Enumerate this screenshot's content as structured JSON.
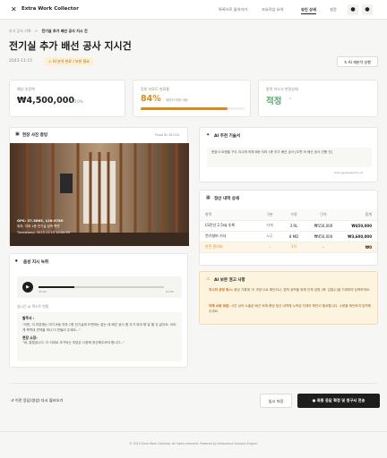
{
  "app": {
    "title": "Extra Work Collector"
  },
  "nav": {
    "items": [
      "특록으로 돌아가기",
      "조요작업 요약",
      "승인 상세",
      "설정"
    ],
    "active_index": 2
  },
  "breadcrumb": {
    "parent": "추가 공사 기록",
    "separator": ">",
    "current": "전기실 추가 배선 공사 지시 건"
  },
  "page": {
    "title": "전기실 추가 배선 공사 지시건",
    "date": "2023-11-15",
    "badge": "AI 분석 완료 / 보완 필요",
    "reanalyze_label": "AI 재분석 실행"
  },
  "stats": {
    "amount": {
      "label": "예상 추정액",
      "value": "₩4,500,000",
      "delta": "+0.0%"
    },
    "progress": {
      "label": "증빙 자료도 완료율",
      "value": "84%",
      "sub": "데이터 보완 대상",
      "fill": 0.84
    },
    "status": {
      "label": "법적 리스크 판정상태",
      "value": "적정",
      "suffix": "⌃"
    }
  },
  "photo": {
    "title": "현장 사진 증빙",
    "photo_id": "Photo ID: 827421",
    "gps": "GPS: 37.5665, 126.9780",
    "location": "위치: 지하 1층 전기실 남측 벽면",
    "timestamp": "Timestamp: 2023-11-15 14:00:09"
  },
  "voice": {
    "title": "음성 지시 녹취",
    "time_start": "00:00",
    "time_end": "02:05",
    "transcript_label": "실시간 AI 텍스트 변환",
    "quote1": "\"이번, 이 부분에는 여기 B동 지하 1층 전기실에 도면에는 없는 데 배선 공사 좀 추가 되야 해 일 할 것 같아요. 이러게 목역내 견적을 하나 더 만들어 주세요...\"",
    "quote2_label": "현장 소장:",
    "quote2": "\"네, 알겠습니다. 다 이대로 추가되는 부분은 나중에 정산해주셔야 합니다...\""
  },
  "summary": {
    "title": "AI 추천 기술서",
    "body": "현장사 요청을 구두 지시에 의해 B동 지하 1층 추가 배선 공사 [도면 외 배선 공사 진행 건]",
    "footer": "Auto-generated by AI"
  },
  "settlement": {
    "title": "정산 내역 상세",
    "headers": [
      "항목",
      "구분",
      "수량",
      "단가",
      "합계"
    ],
    "rows": [
      [
        "LS전선 2.5sq 추록",
        "자재",
        "3 RL",
        "₩150,000",
        "₩450,000"
      ],
      [
        "전기설비 기사",
        "노무",
        "8 MD",
        "₩450,000",
        "₩3,600,000"
      ],
      [
        "안전 관리비",
        "-",
        "1식",
        "-",
        "₩0"
      ]
    ]
  },
  "risk": {
    "title": "AI 보완 권고 사항",
    "item1_label": "지시자 성명 명시:",
    "item1": "음성 기록에 '이 과장'으로 확인되나, 법적 효력을 위해 전체 성명 (예: 김철수)을 기재하여 입력하세요.",
    "item2_label": "자재 수량 보완:",
    "item2": "사진 상의 노출된 배선 외에 증빙 정산 내역에 누락된 자재의 확인이 필요합니다. 수량을 확인하여 입력해 주세요."
  },
  "footer_actions": {
    "back": "이전 응답(생성) 다시 불러오기",
    "save": "임시 저장",
    "submit": "최종 응답 확정 및 청구서 전송"
  },
  "copyright": "© 2023 Extra Work Collector. All rights reserved. Powered by Ambulance Analysis Engine.",
  "colors": {
    "accent_green": "#5aa876",
    "warn_orange": "#d98b1a",
    "warn_bg": "#fdf4e0",
    "dark": "#1e1e1e"
  }
}
